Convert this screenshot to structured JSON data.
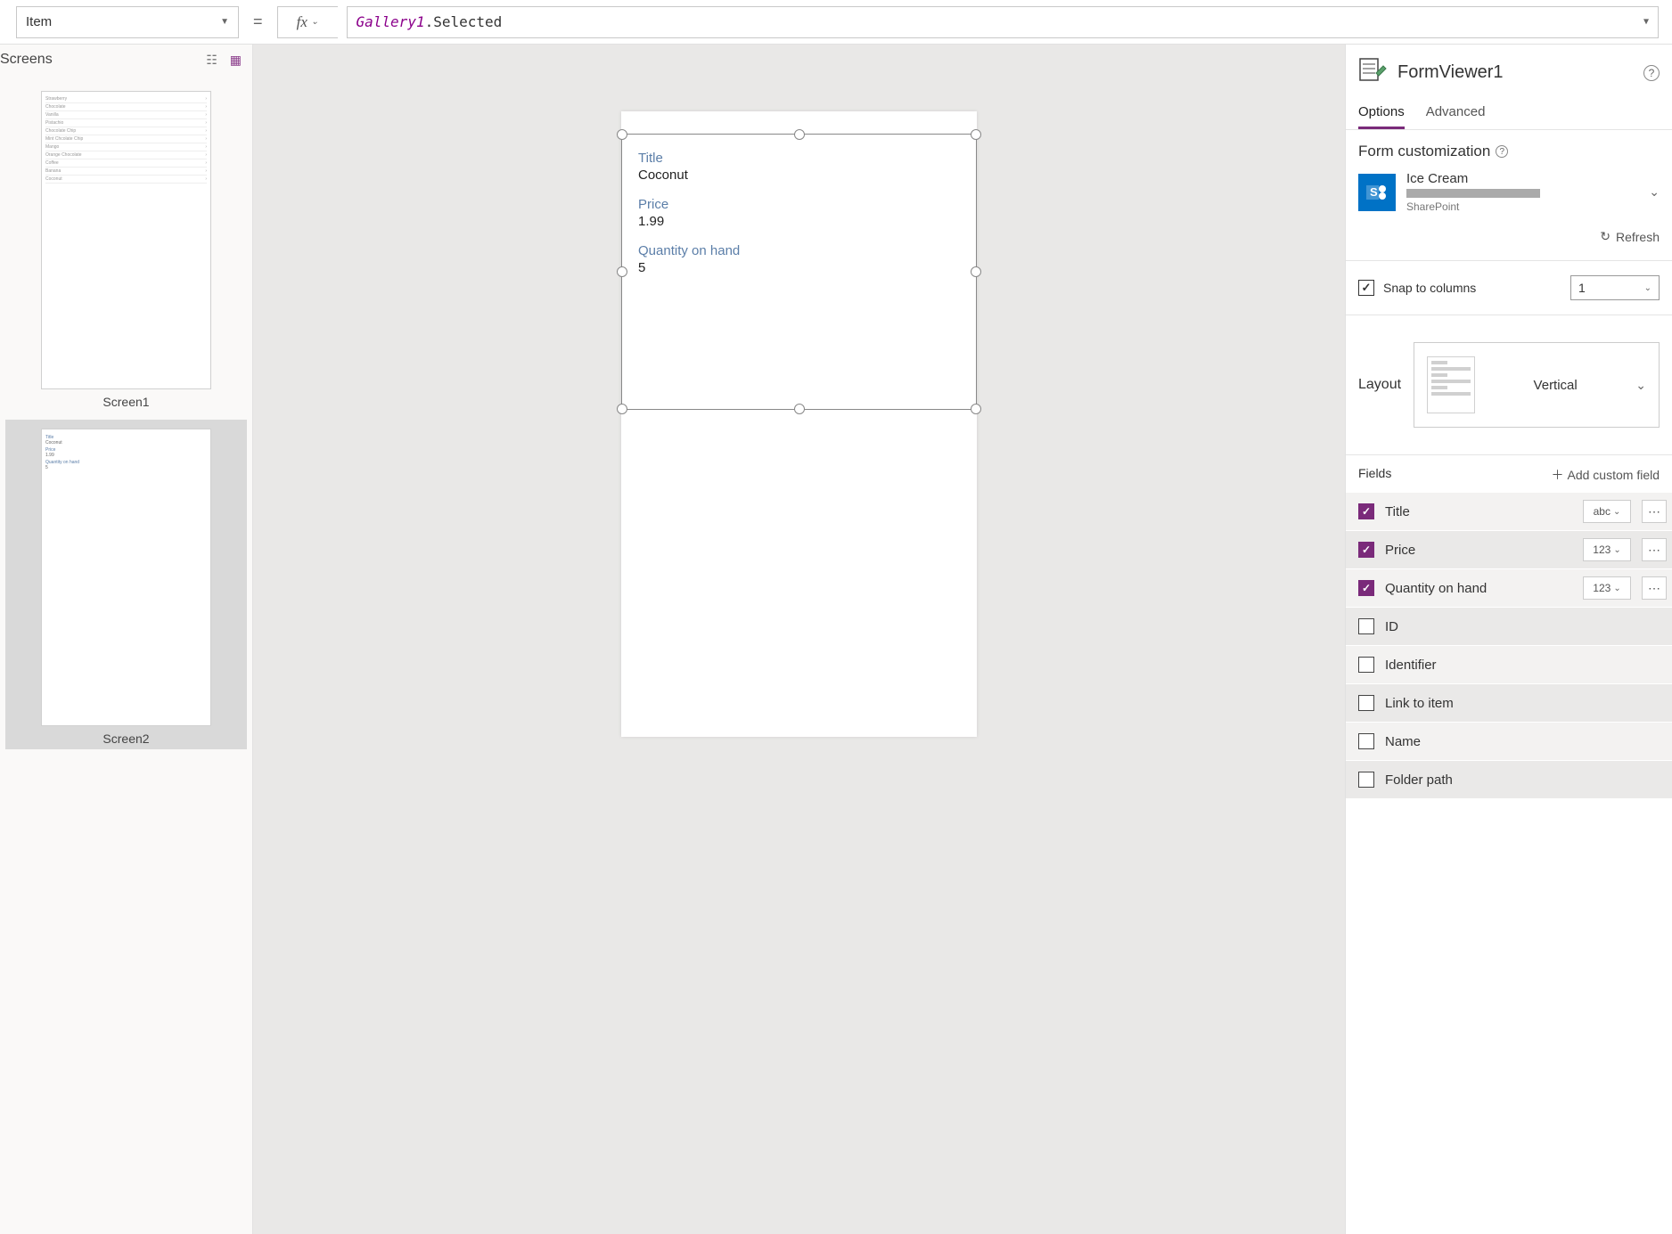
{
  "topbar": {
    "property": "Item",
    "equals": "=",
    "fx_label": "fx",
    "formula_identifier": "Gallery1",
    "formula_property": ".Selected"
  },
  "left": {
    "title": "Screens",
    "screens": [
      {
        "name": "Screen1",
        "selected": false
      },
      {
        "name": "Screen2",
        "selected": true
      }
    ],
    "screen1_items": [
      "Strawberry",
      "Chocolate",
      "Vanilla",
      "Pistachio",
      "Chocolate Chip",
      "Mint Chcolate Chip",
      "Mango",
      "Orange Chocolate",
      "Coffee",
      "Banana",
      "Coconut"
    ]
  },
  "canvas": {
    "form": {
      "fields": [
        {
          "label": "Title",
          "value": "Coconut"
        },
        {
          "label": "Price",
          "value": "1.99"
        },
        {
          "label": "Quantity on hand",
          "value": "5"
        }
      ]
    }
  },
  "right": {
    "title": "FormViewer1",
    "tabs": {
      "options": "Options",
      "advanced": "Advanced",
      "active": "options"
    },
    "form_customization": "Form customization",
    "datasource": {
      "name": "Ice Cream",
      "provider": "SharePoint"
    },
    "refresh": "Refresh",
    "snap_label": "Snap to columns",
    "snap_checked": true,
    "columns_value": "1",
    "layout_label": "Layout",
    "layout_value": "Vertical",
    "fields_label": "Fields",
    "add_field": "Add custom field",
    "fields": [
      {
        "checked": true,
        "name": "Title",
        "type": "abc",
        "alt": false
      },
      {
        "checked": true,
        "name": "Price",
        "type": "123",
        "alt": true
      },
      {
        "checked": true,
        "name": "Quantity on hand",
        "type": "123",
        "alt": false
      },
      {
        "checked": false,
        "name": "ID",
        "type": "",
        "alt": true
      },
      {
        "checked": false,
        "name": "Identifier",
        "type": "",
        "alt": false
      },
      {
        "checked": false,
        "name": "Link to item",
        "type": "",
        "alt": true
      },
      {
        "checked": false,
        "name": "Name",
        "type": "",
        "alt": false
      },
      {
        "checked": false,
        "name": "Folder path",
        "type": "",
        "alt": true
      }
    ]
  }
}
